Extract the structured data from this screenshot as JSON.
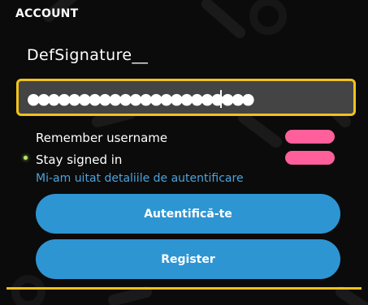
{
  "header": {
    "title": "ACCOUNT"
  },
  "account": {
    "username": "DefSignature__"
  },
  "password_field": {
    "value": "●●●●●●●●●●●●●●●●●●●●●●"
  },
  "options": [
    {
      "label": "Remember username",
      "enabled": true
    },
    {
      "label": "Stay signed in",
      "enabled": true
    }
  ],
  "links": {
    "forgot": "Mi-am uitat detaliile de autentificare"
  },
  "buttons": {
    "login": "Autentifică-te",
    "register": "Register"
  },
  "colors": {
    "accent_yellow": "#f2c21b",
    "toggle_pink": "#ff5f9b",
    "button_blue": "#2e95d3",
    "link_blue": "#4aa3dc",
    "background": "#0b0b0b"
  }
}
